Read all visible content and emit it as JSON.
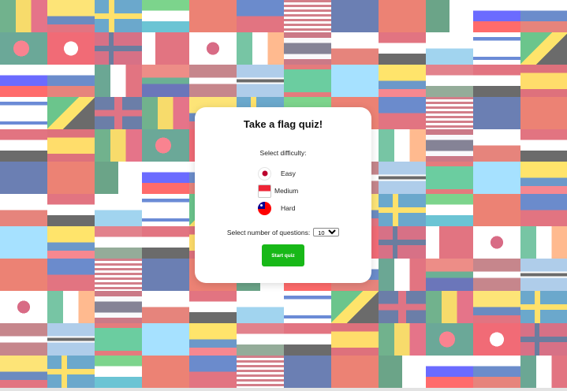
{
  "modal": {
    "title": "Take a flag quiz!",
    "difficulty_label": "Select difficulty:",
    "difficulties": [
      {
        "label": "Easy",
        "flag_icon": "japan-flag-icon"
      },
      {
        "label": "Medium",
        "flag_icon": "singapore-flag-icon"
      },
      {
        "label": "Hard",
        "flag_icon": "taiwan-flag-icon"
      }
    ],
    "questions_label": "Select number of questions:",
    "questions_value": "10",
    "start_label": "Start quiz"
  },
  "colors": {
    "start_button": "#18b818",
    "modal_bg": "#ffffff",
    "overlay": "rgba(255,255,255,0.42)"
  },
  "background_flags": [
    "tricolor-flag-icon",
    "iraq-flag-icon",
    "bahrain-flag-icon",
    "spain-flag-icon",
    "mauritania-flag-icon",
    "russia-flag-icon",
    "usa-flag-icon",
    "colombia-flag-icon",
    "san-marino-flag-icon",
    "japan-flag-icon",
    "tricolor-flag-icon",
    "saint-lucia-flag-icon",
    "mexico-flag-icon",
    "new-zealand-flag-icon",
    "sweden-flag-icon",
    "israel-flag-icon",
    "ireland-flag-icon",
    "bangladesh-flag-icon",
    "ecuador-flag-icon",
    "south-africa-flag-icon",
    "china-flag-icon",
    "uzbekistan-flag-icon",
    "jamaica-flag-icon",
    "thailand-flag-icon",
    "tunisia-flag-icon",
    "hungary-flag-icon",
    "latvia-flag-icon",
    "algeria-flag-icon",
    "hong-kong-flag-icon",
    "uk-flag-icon",
    "chile-flag-icon",
    "norway-flag-icon",
    "egypt-flag-icon",
    "botswana-flag-icon",
    "slovenia-flag-icon",
    "philippines-flag-icon"
  ]
}
